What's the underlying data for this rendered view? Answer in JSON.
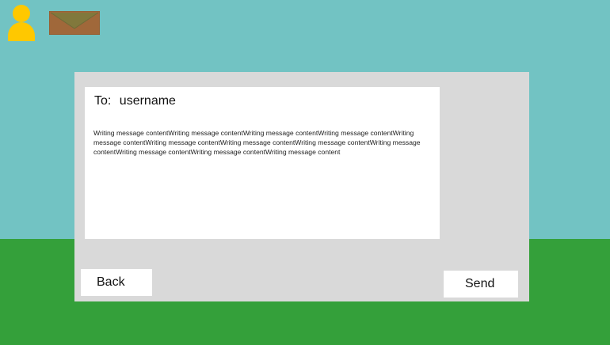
{
  "compose": {
    "to_label": "To:",
    "recipient": "username",
    "message": "Writing message contentWriting message contentWriting message contentWriting message contentWriting message contentWriting message contentWriting message contentWriting message contentWriting message contentWriting message contentWriting message contentWriting message content"
  },
  "buttons": {
    "back_label": "Back",
    "send_label": "Send"
  },
  "icons": {
    "user": "user-icon",
    "mail": "mail-icon"
  },
  "colors": {
    "sky": "#72c3c3",
    "ground": "#34a03a",
    "panel": "#d9d9d9",
    "avatar": "#ffc800",
    "envelope": "#a0683a"
  }
}
